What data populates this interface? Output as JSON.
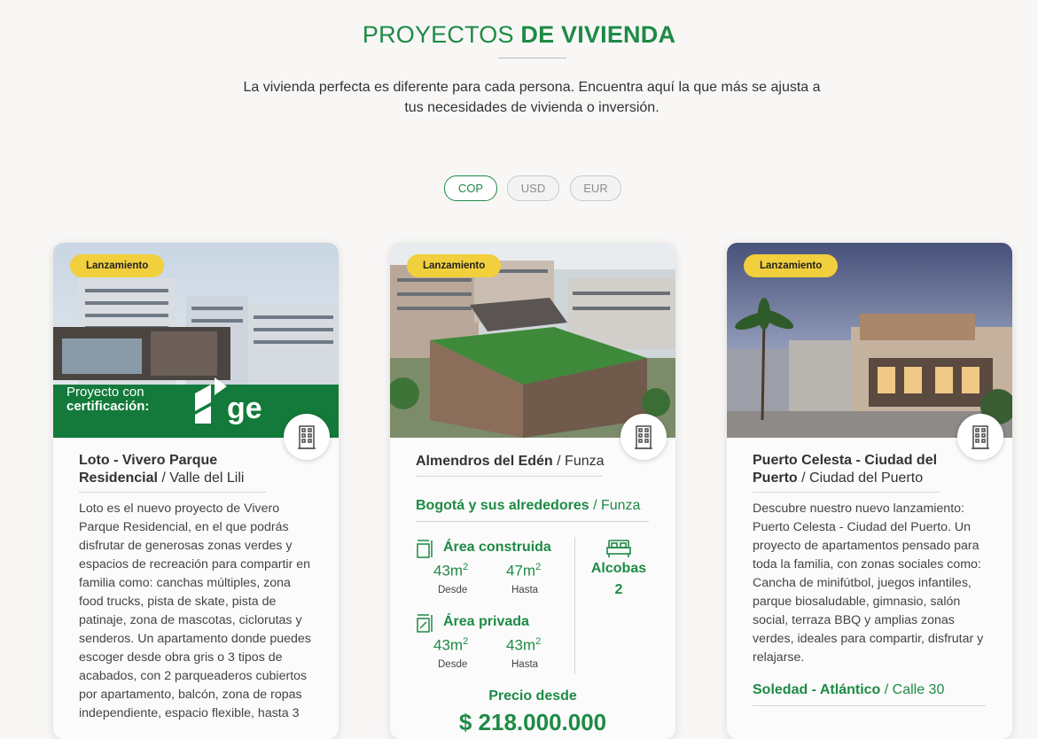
{
  "section": {
    "title_light": "PROYECTOS ",
    "title_bold": "DE VIVIENDA",
    "subtitle": "La vivienda perfecta es diferente para cada persona. Encuentra aquí la que más se ajusta a tus necesidades de vivienda o inversión."
  },
  "currency": {
    "options": [
      "COP",
      "USD",
      "EUR"
    ],
    "selected": "COP"
  },
  "cards": [
    {
      "badge": "Lanzamiento",
      "overlay_line1": "Proyecto con",
      "overlay_line2": "certificación:",
      "name": "Loto - Vivero Parque Residencial",
      "location": " / Valle del Lili",
      "description": "Loto es el nuevo proyecto de Vivero Parque Residencial, en el que podrás disfrutar de generosas zonas verdes y espacios de recreación para compartir en familia como: canchas múltiples, zona food trucks, pista de skate, pista de patinaje, zona de mascotas, ciclorutas y senderos.  Un apartamento donde puedes escoger desde obra gris o 3 tipos de acabados, con 2 parqueaderos cubiertos por apartamento, balcón, zona de ropas independiente, espacio flexible, hasta 3",
      "type_icon": "building-icon"
    },
    {
      "badge": "Lanzamiento",
      "name": "Almendros del Edén",
      "location": " / Funza",
      "region": "Bogotá y sus alrededores",
      "region_city": " / Funza",
      "built_area_label": "Área construida",
      "built_from": "43m",
      "built_to": "47m",
      "private_area_label": "Área privada",
      "private_from": "43m",
      "private_to": "43m",
      "from_label": "Desde",
      "to_label": "Hasta",
      "bedrooms_label": "Alcobas",
      "bedrooms_value": "2",
      "price_label": "Precio desde",
      "price_value": "$ 218.000.000",
      "type_icon": "building-icon"
    },
    {
      "badge": "Lanzamiento",
      "name": "Puerto Celesta - Ciudad del Puerto",
      "location": " / Ciudad del Puerto",
      "description": "Descubre nuestro nuevo lanzamiento: Puerto Celesta - Ciudad del Puerto. Un proyecto de apartamentos pensado para toda la familia, con zonas sociales como: Cancha de minifútbol, juegos infantiles, parque biosaludable, gimnasio, salón social, terraza BBQ y amplias zonas verdes, ideales para compartir, disfrutar y relajarse.",
      "region": "Soledad - Atlántico",
      "region_city": " / Calle 30",
      "type_icon": "building-icon"
    }
  ],
  "colors": {
    "brand_green": "#1e8a45",
    "badge_yellow": "#f2cf3c"
  }
}
